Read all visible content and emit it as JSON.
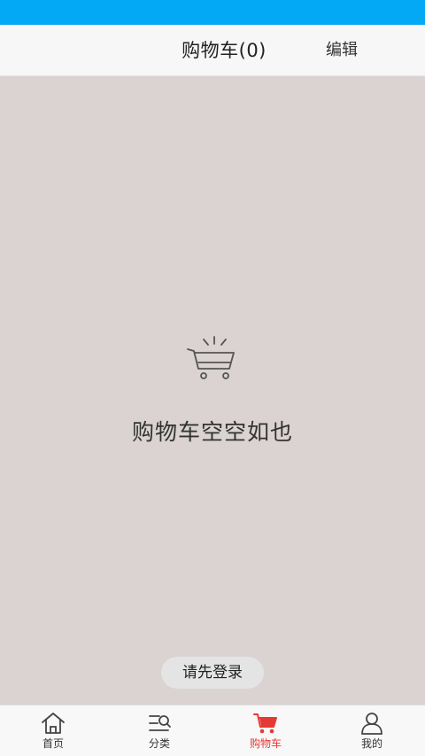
{
  "header": {
    "title": "购物车(0)",
    "edit_label": "编辑"
  },
  "main": {
    "empty_message": "购物车空空如也",
    "login_button": "请先登录"
  },
  "tabbar": {
    "active_color": "#e53935",
    "items": [
      {
        "label": "首页",
        "icon": "home-icon"
      },
      {
        "label": "分类",
        "icon": "category-search-icon"
      },
      {
        "label": "购物车",
        "icon": "cart-icon",
        "active": true
      },
      {
        "label": "我的",
        "icon": "user-icon"
      }
    ]
  },
  "colors": {
    "status_bar": "#03a9f4",
    "header_bg": "#f7f7f7",
    "content_bg": "#dad3d2",
    "tabbar_bg": "#f8f8f8"
  }
}
